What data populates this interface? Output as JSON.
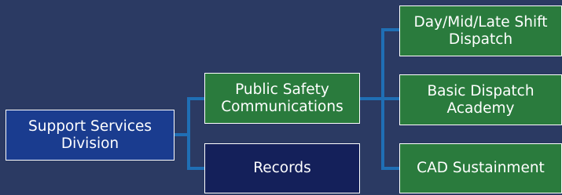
{
  "nodes": {
    "root": {
      "label": "Support Services\nDivision"
    },
    "psc": {
      "label": "Public Safety\nCommunications"
    },
    "records": {
      "label": "Records"
    },
    "shift": {
      "label": "Day/Mid/Late Shift\nDispatch"
    },
    "academy": {
      "label": "Basic Dispatch\nAcademy"
    },
    "cad": {
      "label": "CAD Sustainment"
    }
  },
  "edges": [
    {
      "from": "root",
      "to": "psc"
    },
    {
      "from": "root",
      "to": "records"
    },
    {
      "from": "psc",
      "to": "shift"
    },
    {
      "from": "psc",
      "to": "academy"
    },
    {
      "from": "psc",
      "to": "cad"
    }
  ],
  "colors": {
    "background": "#2b3a63",
    "connector": "#1f6fb5",
    "node_border": "#ffffff",
    "node_text": "#ffffff",
    "root_fill": "#1a3c8f",
    "green_fill": "#2a7b3d",
    "records_fill": "#14205a"
  }
}
